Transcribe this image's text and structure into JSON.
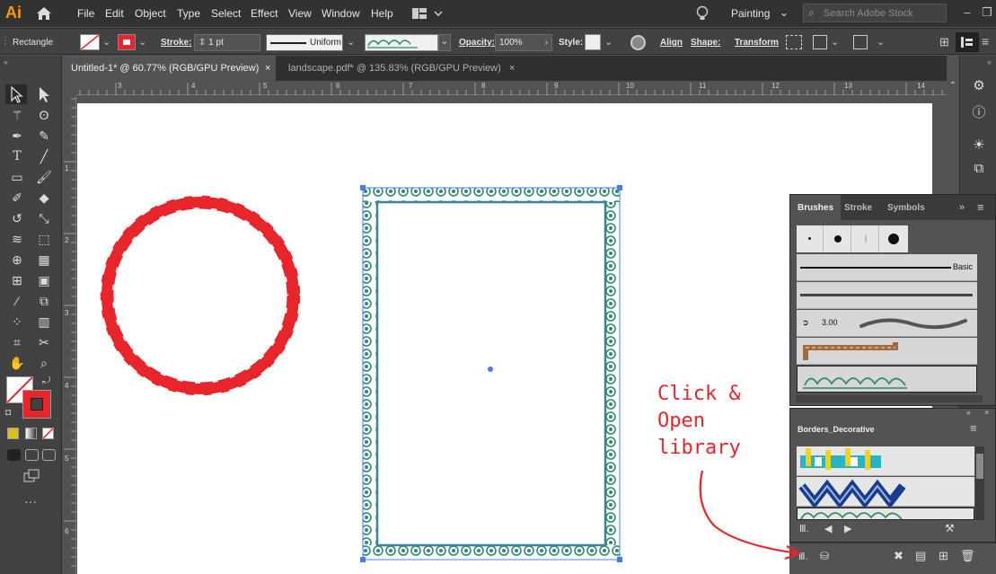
{
  "app": {
    "logo": "Ai"
  },
  "menu": [
    "File",
    "Edit",
    "Object",
    "Type",
    "Select",
    "Effect",
    "View",
    "Window",
    "Help"
  ],
  "workspace": {
    "label": "Painting"
  },
  "search": {
    "placeholder": "Search Adobe Stock"
  },
  "control": {
    "selection": "Rectangle",
    "stroke_label": "Stroke:",
    "stroke_value": "1 pt",
    "profile": "Uniform",
    "opacity_label": "Opacity:",
    "opacity_value": "100%",
    "style_label": "Style:",
    "align": "Align",
    "shape": "Shape:",
    "transform": "Transform"
  },
  "tabs": [
    {
      "label": "Untitled-1* @ 60.77% (RGB/GPU Preview)",
      "active": true
    },
    {
      "label": "landscape.pdf* @ 135.83% (RGB/GPU Preview)",
      "active": false
    }
  ],
  "ruler": {
    "top": [
      "3",
      "4",
      "5",
      "6",
      "7",
      "8",
      "9",
      "10",
      "11",
      "12",
      "13",
      "14"
    ],
    "left": [
      "1",
      "2",
      "3",
      "4",
      "5",
      "6"
    ]
  },
  "brushes_panel": {
    "tabs": [
      "Brushes",
      "Stroke",
      "Symbols"
    ],
    "basic_label": "Basic",
    "calligraphic_size": "3.00"
  },
  "borders_panel": {
    "title": "Borders_Decorative"
  },
  "annotation": {
    "lines": [
      "Click &",
      "Open",
      "library"
    ]
  },
  "colors": {
    "accent_stroke": "#e8252a",
    "border_green": "#2e8a6a",
    "selection_blue": "#4a7cf0",
    "ui_dark": "#323232",
    "ui_mid": "#424242"
  }
}
